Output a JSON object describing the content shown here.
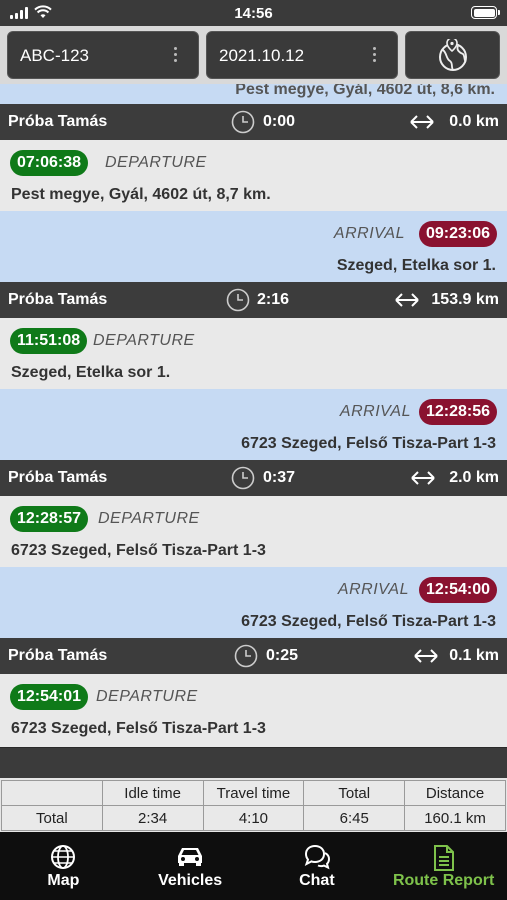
{
  "status_bar": {
    "time": "14:56"
  },
  "toolbar": {
    "vehicle_value": "ABC-123",
    "date_value": "2021.10.12",
    "map_button_icon": "globe-pin-icon"
  },
  "list": {
    "partial_address": "Pest megye, Gyál, 4602 út, 8,6 km.",
    "entries": [
      {
        "type": "drive",
        "driver": "Próba Tamás",
        "duration": "0:00",
        "distance": "0.0 km"
      },
      {
        "type": "departure",
        "time": "07:06:38",
        "label": "DEPARTURE",
        "address": "Pest megye, Gyál, 4602 út, 8,7 km."
      },
      {
        "type": "arrival",
        "time": "09:23:06",
        "label": "ARRIVAL",
        "address": "Szeged, Etelka sor 1."
      },
      {
        "type": "drive",
        "driver": "Próba Tamás",
        "duration": "2:16",
        "distance": "153.9 km"
      },
      {
        "type": "departure",
        "time": "11:51:08",
        "label": "DEPARTURE",
        "address": "Szeged, Etelka sor 1."
      },
      {
        "type": "arrival",
        "time": "12:28:56",
        "label": "ARRIVAL",
        "address": "6723 Szeged, Felső Tisza-Part 1-3"
      },
      {
        "type": "drive",
        "driver": "Próba Tamás",
        "duration": "0:37",
        "distance": "2.0 km"
      },
      {
        "type": "departure",
        "time": "12:28:57",
        "label": "DEPARTURE",
        "address": "6723 Szeged, Felső Tisza-Part 1-3"
      },
      {
        "type": "arrival",
        "time": "12:54:00",
        "label": "ARRIVAL",
        "address": "6723 Szeged, Felső Tisza-Part 1-3"
      },
      {
        "type": "drive",
        "driver": "Próba Tamás",
        "duration": "0:25",
        "distance": "0.1 km"
      },
      {
        "type": "departure",
        "time": "12:54:01",
        "label": "DEPARTURE",
        "address": "6723 Szeged, Felső Tisza-Part 1-3"
      }
    ]
  },
  "summary": {
    "headers": [
      "",
      "Idle time",
      "Travel time",
      "Total",
      "Distance"
    ],
    "row": [
      "Total",
      "2:34",
      "4:10",
      "6:45",
      "160.1 km"
    ]
  },
  "nav": {
    "items": [
      {
        "label": "Map",
        "icon": "globe-icon"
      },
      {
        "label": "Vehicles",
        "icon": "car-icon"
      },
      {
        "label": "Chat",
        "icon": "chat-bubbles-icon"
      },
      {
        "label": "Route Report",
        "icon": "document-icon",
        "active": true
      }
    ]
  },
  "colors": {
    "departure_pill": "#0f7a19",
    "arrival_pill": "#8a1230",
    "active_tab": "#7ec24b",
    "arrival_row_bg": "#c6daf3"
  }
}
